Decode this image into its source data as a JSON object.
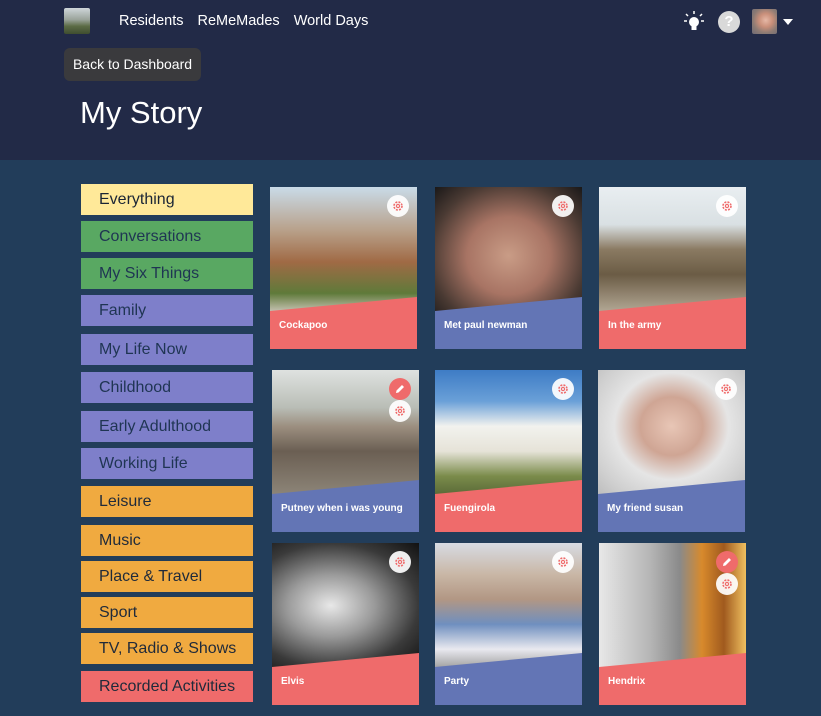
{
  "nav": {
    "items": [
      "Residents",
      "ReMeMades",
      "World Days"
    ]
  },
  "header": {
    "back_label": "Back to Dashboard",
    "help_label": "?",
    "title": "My Story"
  },
  "icons": {
    "logo": "logo-icon",
    "bulb": "lightbulb-icon",
    "help": "help-icon",
    "avatar": "avatar",
    "caret": "caret-down-icon",
    "gear": "gear-icon",
    "pen": "pencil-icon"
  },
  "colors": {
    "topbar": "#222a47",
    "page_bg": "#223d5a",
    "yellow": "#ffe999",
    "green": "#59a862",
    "purple": "#7e7fca",
    "orange": "#f0aa40",
    "salmon": "#ef6b6b",
    "card_blue": "#6375b5"
  },
  "categories": [
    {
      "label": "Everything",
      "color": "#ffe999",
      "text": "#1a2535"
    },
    {
      "label": "Conversations",
      "color": "#59a862",
      "text": "#1f3553"
    },
    {
      "label": "My Six Things",
      "color": "#59a862",
      "text": "#1f3553"
    },
    {
      "label": "Family",
      "color": "#7e7fca",
      "text": "#1f3553"
    },
    {
      "label": "My Life Now",
      "color": "#7e7fca",
      "text": "#1f3553"
    },
    {
      "label": "Childhood",
      "color": "#7e7fca",
      "text": "#1f3553"
    },
    {
      "label": "Early Adulthood",
      "color": "#7e7fca",
      "text": "#1f3553"
    },
    {
      "label": "Working Life",
      "color": "#7e7fca",
      "text": "#1f3553"
    },
    {
      "label": "Leisure",
      "color": "#f0aa40",
      "text": "#1f2a3a"
    },
    {
      "label": "Music",
      "color": "#f0aa40",
      "text": "#1f2a3a"
    },
    {
      "label": "Place & Travel",
      "color": "#f0aa40",
      "text": "#1f2a3a"
    },
    {
      "label": "Sport",
      "color": "#f0aa40",
      "text": "#1f2a3a"
    },
    {
      "label": "TV, Radio & Shows",
      "color": "#f0aa40",
      "text": "#1f2a3a"
    },
    {
      "label": "Recorded Activities",
      "color": "#ef6b6b",
      "text": "#1f2a3a"
    }
  ],
  "cards": [
    {
      "label": "Cockapoo",
      "band": "red"
    },
    {
      "label": "Met paul newman",
      "band": "blue"
    },
    {
      "label": "In the army",
      "band": "red"
    },
    {
      "label": "Putney when i was young",
      "band": "blue"
    },
    {
      "label": "Fuengirola",
      "band": "red"
    },
    {
      "label": "My friend susan",
      "band": "blue"
    },
    {
      "label": "Elvis",
      "band": "red"
    },
    {
      "label": "Party",
      "band": "blue"
    },
    {
      "label": "Hendrix",
      "band": "red"
    }
  ]
}
